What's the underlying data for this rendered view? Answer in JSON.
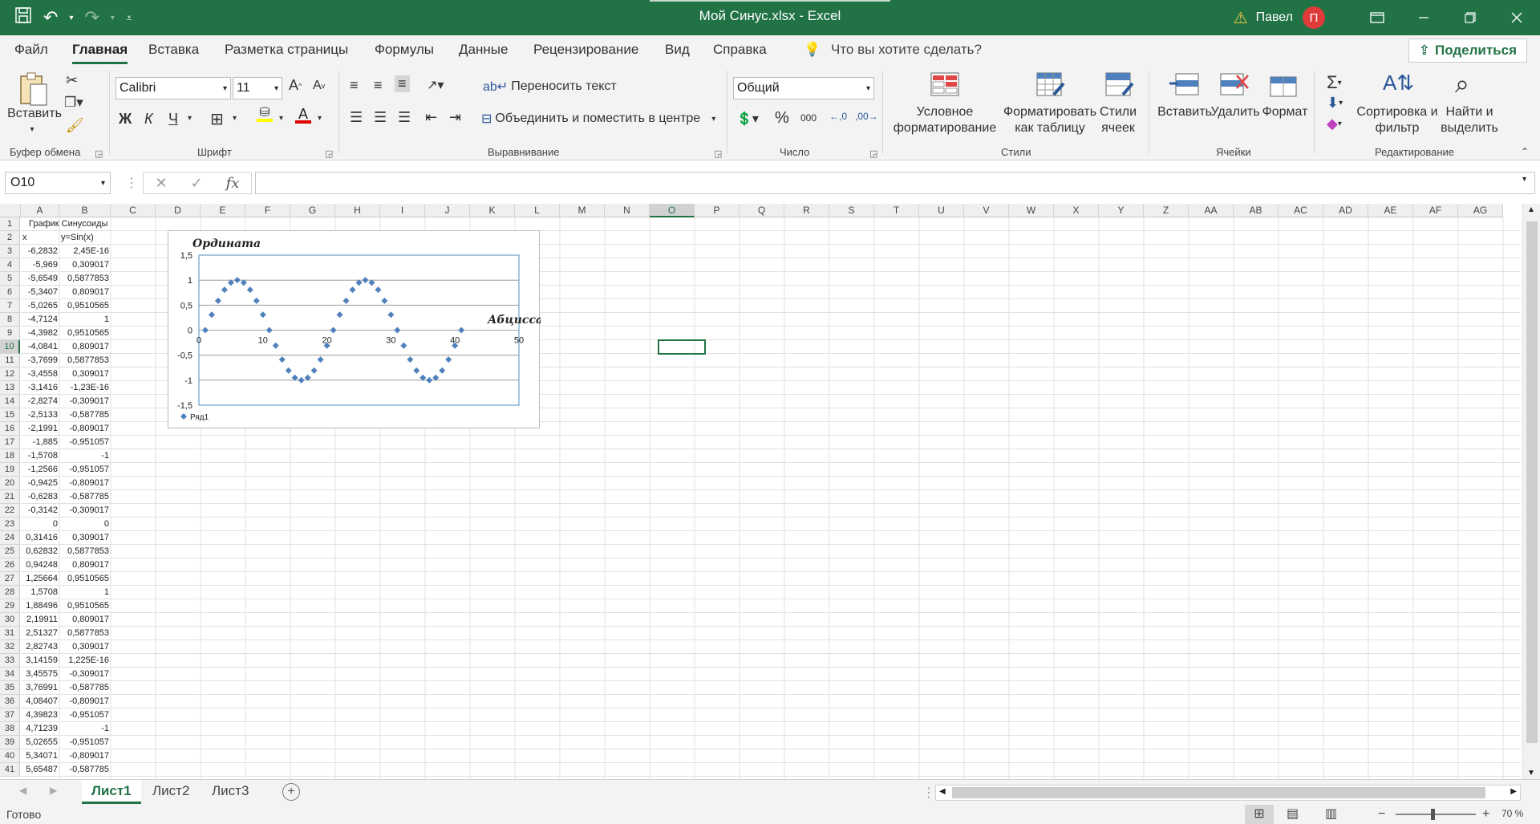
{
  "titlebar": {
    "title": "Мой Синус.xlsx  -  Excel",
    "username": "Павел",
    "avatar_initial": "П"
  },
  "tabs": [
    "Файл",
    "Главная",
    "Вставка",
    "Разметка страницы",
    "Формулы",
    "Данные",
    "Рецензирование",
    "Вид",
    "Справка"
  ],
  "search_placeholder": "Что вы хотите сделать?",
  "share_label": "Поделиться",
  "ribbon": {
    "paste_label": "Вставить",
    "clipboard_group": "Буфер обмена",
    "font_name": "Calibri",
    "font_size": "11",
    "bold": "Ж",
    "italic": "К",
    "underline": "Ч",
    "font_group": "Шрифт",
    "wrap_text": "Переносить текст",
    "merge_center": "Объединить и поместить в центре",
    "alignment_group": "Выравнивание",
    "number_format": "Общий",
    "percent": "%",
    "thousands": "000",
    "number_group": "Число",
    "conditional_format": "Условное форматирование",
    "format_as_table": "Форматировать как таблицу",
    "cell_styles": "Стили ячеек",
    "styles_group": "Стили",
    "insert": "Вставить",
    "delete": "Удалить",
    "format": "Формат",
    "cells_group": "Ячейки",
    "sort_filter": "Сортировка и фильтр",
    "find_select": "Найти и выделить",
    "editing_group": "Редактирование"
  },
  "namebox": "O10",
  "fx_label": "fx",
  "columns": [
    "A",
    "B",
    "C",
    "D",
    "E",
    "F",
    "G",
    "H",
    "I",
    "J",
    "K",
    "L",
    "M",
    "N",
    "O",
    "P",
    "Q",
    "R",
    "S",
    "T",
    "U",
    "V",
    "W",
    "X",
    "Y",
    "Z",
    "AA",
    "AB",
    "AC",
    "AD",
    "AE",
    "AF",
    "AG"
  ],
  "selected_column": "O",
  "selected_row": "10",
  "sheet": {
    "a1": "График Синусоиды",
    "a2": "x",
    "b2": "y=Sin(x)",
    "x_values": [
      "-6,2832",
      "-5,969",
      "-5,6549",
      "-5,3407",
      "-5,0265",
      "-4,7124",
      "-4,3982",
      "-4,0841",
      "-3,7699",
      "-3,4558",
      "-3,1416",
      "-2,8274",
      "-2,5133",
      "-2,1991",
      "-1,885",
      "-1,5708",
      "-1,2566",
      "-0,9425",
      "-0,6283",
      "-0,3142",
      "0",
      "0,31416",
      "0,62832",
      "0,94248",
      "1,25664",
      "1,5708",
      "1,88496",
      "2,19911",
      "2,51327",
      "2,82743",
      "3,14159",
      "3,45575",
      "3,76991",
      "4,08407",
      "4,39823",
      "4,71239",
      "5,02655",
      "5,34071",
      "5,65487"
    ],
    "y_values": [
      "2,45E-16",
      "0,309017",
      "0,5877853",
      "0,809017",
      "0,9510565",
      "1",
      "0,9510565",
      "0,809017",
      "0,5877853",
      "0,309017",
      "-1,23E-16",
      "-0,309017",
      "-0,587785",
      "-0,809017",
      "-0,951057",
      "-1",
      "-0,951057",
      "-0,809017",
      "-0,587785",
      "-0,309017",
      "0",
      "0,309017",
      "0,5877853",
      "0,809017",
      "0,9510565",
      "1",
      "0,9510565",
      "0,809017",
      "0,5877853",
      "0,309017",
      "1,225E-16",
      "-0,309017",
      "-0,587785",
      "-0,809017",
      "-0,951057",
      "-1",
      "-0,951057",
      "-0,809017",
      "-0,587785"
    ]
  },
  "chart_data": {
    "type": "scatter",
    "ylabel": "Ордината",
    "xlabel": "Абцисса",
    "xlim": [
      0,
      50
    ],
    "ylim": [
      -1.5,
      1.5
    ],
    "x_ticks": [
      "0",
      "10",
      "20",
      "30",
      "40",
      "50"
    ],
    "y_ticks": [
      "1,5",
      "1",
      "0,5",
      "0",
      "-0,5",
      "-1",
      "-1,5"
    ],
    "legend": "Ряд1",
    "series_color": "#4f81bd",
    "series": [
      {
        "name": "Ряд1",
        "x": [
          1,
          2,
          3,
          4,
          5,
          6,
          7,
          8,
          9,
          10,
          11,
          12,
          13,
          14,
          15,
          16,
          17,
          18,
          19,
          20,
          21,
          22,
          23,
          24,
          25,
          26,
          27,
          28,
          29,
          30,
          31,
          32,
          33,
          34,
          35,
          36,
          37,
          38,
          39,
          40,
          41
        ],
        "values": [
          0,
          0.309,
          0.588,
          0.809,
          0.951,
          1,
          0.951,
          0.809,
          0.588,
          0.309,
          0,
          -0.309,
          -0.588,
          -0.809,
          -0.951,
          -1,
          -0.951,
          -0.809,
          -0.588,
          -0.309,
          0,
          0.309,
          0.588,
          0.809,
          0.951,
          1,
          0.951,
          0.809,
          0.588,
          0.309,
          0,
          -0.309,
          -0.588,
          -0.809,
          -0.951,
          -1,
          -0.951,
          -0.809,
          -0.588,
          -0.309,
          0
        ]
      }
    ]
  },
  "sheets": [
    "Лист1",
    "Лист2",
    "Лист3"
  ],
  "active_sheet": "Лист1",
  "status": "Готово",
  "zoom": "70 %",
  "colors": {
    "excel_green": "#217346"
  }
}
